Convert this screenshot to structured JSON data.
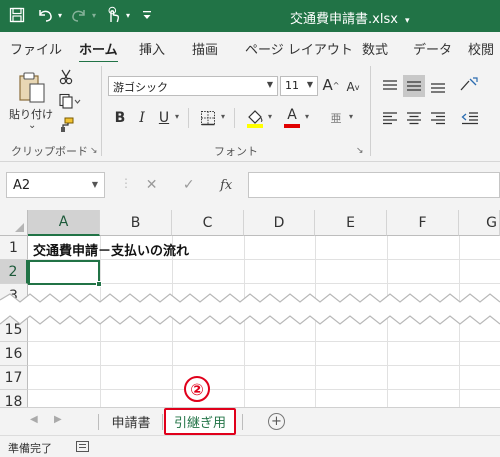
{
  "app": {
    "title": "交通費申請書.xlsx",
    "title_dropdown_icon": "chevron-down-icon",
    "accent_color": "#217346",
    "highlight_color": "#e0001b"
  },
  "quick_access": {
    "items": [
      "save-icon",
      "undo-icon",
      "redo-icon",
      "touch-mode-icon",
      "customize-qat-icon"
    ]
  },
  "ribbon": {
    "tabs": [
      "ファイル",
      "ホーム",
      "挿入",
      "描画",
      "ページ レイアウト",
      "数式",
      "データ",
      "校閲"
    ],
    "active_tab": "ホーム",
    "clipboard": {
      "group_label": "クリップボード",
      "paste_label": "貼り付け",
      "paste_arrow": "⌄"
    },
    "font": {
      "group_label": "フォント",
      "font_name": "游ゴシック",
      "font_size": "11",
      "grow_label": "A",
      "shrink_label": "A",
      "bold_label": "B",
      "italic_label": "I",
      "underline_label": "U",
      "font_color_label": "A",
      "phonetic_label": "亜",
      "highlight_fill_color": "#ffff00",
      "font_color_bar": "#e00000"
    }
  },
  "formula_bar": {
    "name_box": "A2",
    "fx_label": "fx",
    "formula": ""
  },
  "grid": {
    "columns": [
      "A",
      "B",
      "C",
      "D",
      "E",
      "F",
      "G"
    ],
    "selected_column": "A",
    "rows_top": [
      "1",
      "2",
      "3"
    ],
    "rows_bottom": [
      "15",
      "16",
      "17",
      "18"
    ],
    "selected_row": "2",
    "cells": {
      "A1": "交通費申請－支払いの流れ",
      "A2": ""
    },
    "active_cell": "A2"
  },
  "sheets": {
    "tabs": [
      "申請書",
      "引継ぎ用"
    ],
    "active": "引継ぎ用",
    "add_label": "+"
  },
  "annotation": {
    "marker_label": "②"
  },
  "status": {
    "text": "準備完了"
  }
}
